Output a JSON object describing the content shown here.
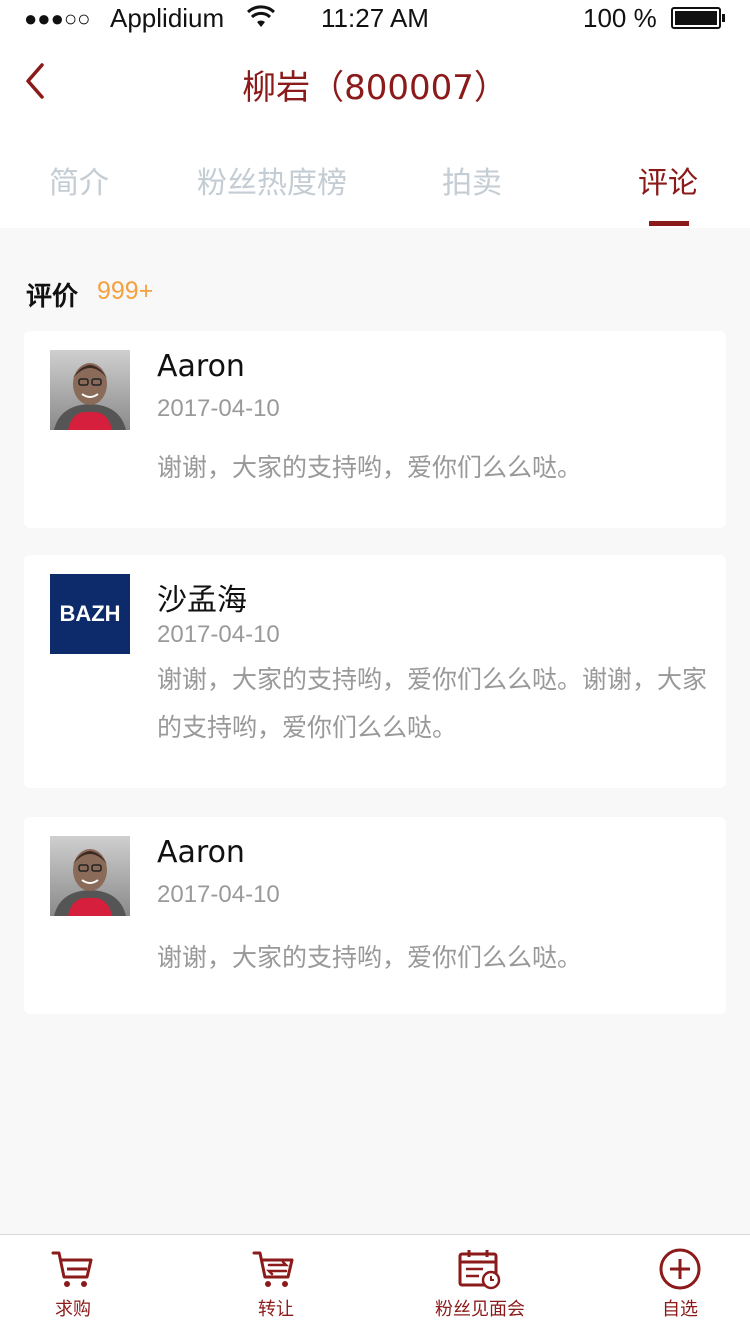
{
  "status_bar": {
    "signal": "●●●○○",
    "carrier": "Applidium",
    "time": "11:27 AM",
    "battery": "100 %"
  },
  "header": {
    "title": "柳岩（800007）"
  },
  "tabs": [
    {
      "label": "简介",
      "active": false
    },
    {
      "label": "粉丝热度榜",
      "active": false
    },
    {
      "label": "拍卖",
      "active": false
    },
    {
      "label": "评论",
      "active": true
    }
  ],
  "section": {
    "title": "评价",
    "count": "999+"
  },
  "comments": [
    {
      "author": "Aaron",
      "date": "2017-04-10",
      "text": "谢谢，大家的支持哟，爱你们么么哒。",
      "avatar": "photo"
    },
    {
      "author": "沙孟海",
      "date": "2017-04-10",
      "text": "谢谢，大家的支持哟，爱你们么么哒。谢谢，大家的支持哟，爱你们么么哒。",
      "avatar": "logo",
      "avatar_text": "BAZH"
    },
    {
      "author": "Aaron",
      "date": "2017-04-10",
      "text": "谢谢，大家的支持哟，爱你们么么哒。",
      "avatar": "photo"
    }
  ],
  "bottom_nav": [
    {
      "label": "求购",
      "icon": "cart-icon"
    },
    {
      "label": "转让",
      "icon": "transfer-cart-icon"
    },
    {
      "label": "粉丝见面会",
      "icon": "calendar-clock-icon"
    },
    {
      "label": "自选",
      "icon": "plus-circle-icon"
    }
  ],
  "colors": {
    "accent": "#8b1a1a",
    "count": "#f5a040",
    "tab_inactive": "#c4ccd4",
    "logo_bg": "#0d2a6b"
  }
}
